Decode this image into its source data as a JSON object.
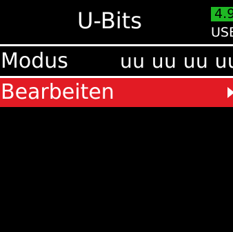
{
  "screen": {
    "title": "U-Bits",
    "battery": {
      "level": "4.9",
      "source": "USB",
      "color": "#1fb824"
    }
  },
  "menu": {
    "items": [
      {
        "label": "Modus",
        "value": "uu uu uu uu"
      },
      {
        "label": "Bearbeiten",
        "selected": true,
        "icon": "arrow-right-icon"
      }
    ]
  },
  "colors": {
    "background": "#000000",
    "text": "#ffffff",
    "highlight": "#e21b24"
  }
}
